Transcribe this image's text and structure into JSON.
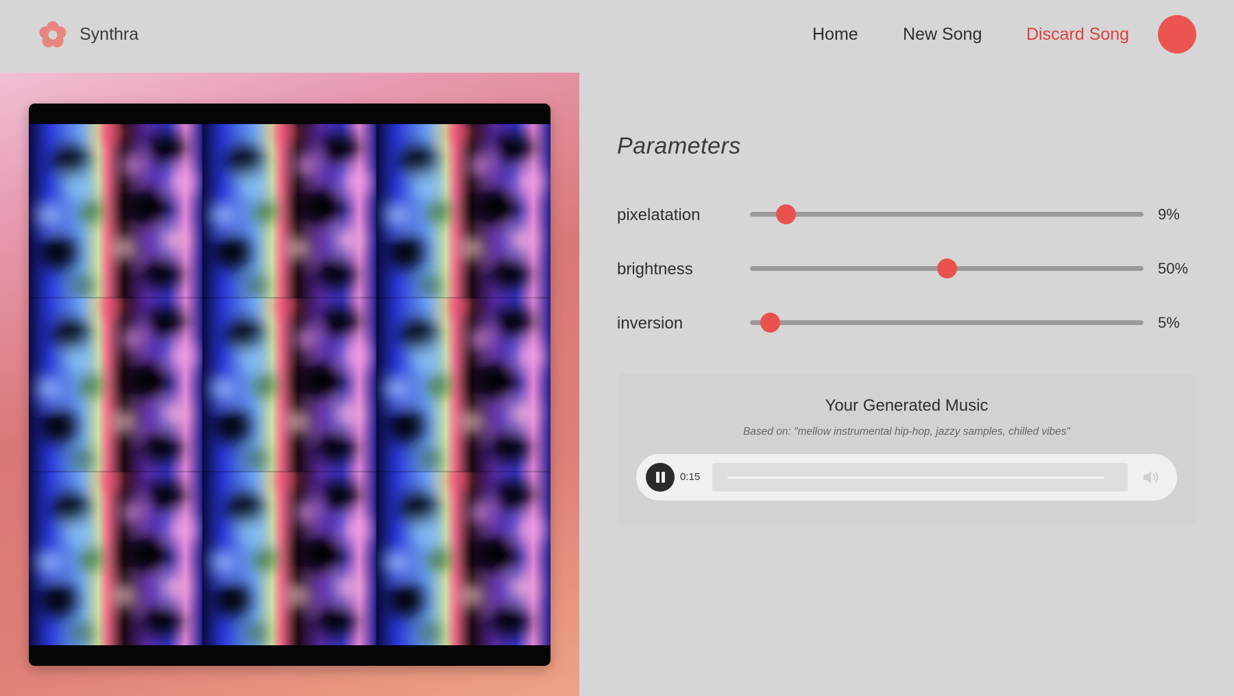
{
  "header": {
    "brand": "Synthra",
    "logo_icon": "flower-logo-icon",
    "nav": {
      "home": "Home",
      "new_song": "New Song",
      "discard_song": "Discard Song"
    },
    "avatar_color": "#eb5550"
  },
  "artwork": {
    "description_icon": "generated-art-image",
    "background_gradient": [
      "#f1bfd6",
      "#d97878",
      "#eea385"
    ]
  },
  "parameters": {
    "title": "Parameters",
    "items": [
      {
        "label": "pixelatation",
        "value": 9,
        "display": "9%"
      },
      {
        "label": "brightness",
        "value": 50,
        "display": "50%"
      },
      {
        "label": "inversion",
        "value": 5,
        "display": "5%"
      }
    ]
  },
  "music": {
    "title": "Your Generated Music",
    "based_on": "Based on: \"mellow instrumental hip-hop, jazzy samples, chilled vibes\"",
    "player": {
      "state": "playing",
      "play_icon": "pause-icon",
      "current_time": "0:15",
      "volume_icon": "volume-icon"
    }
  },
  "colors": {
    "accent": "#e9514e",
    "discard": "#e0403e",
    "page_bg": "#d6d6d6"
  }
}
